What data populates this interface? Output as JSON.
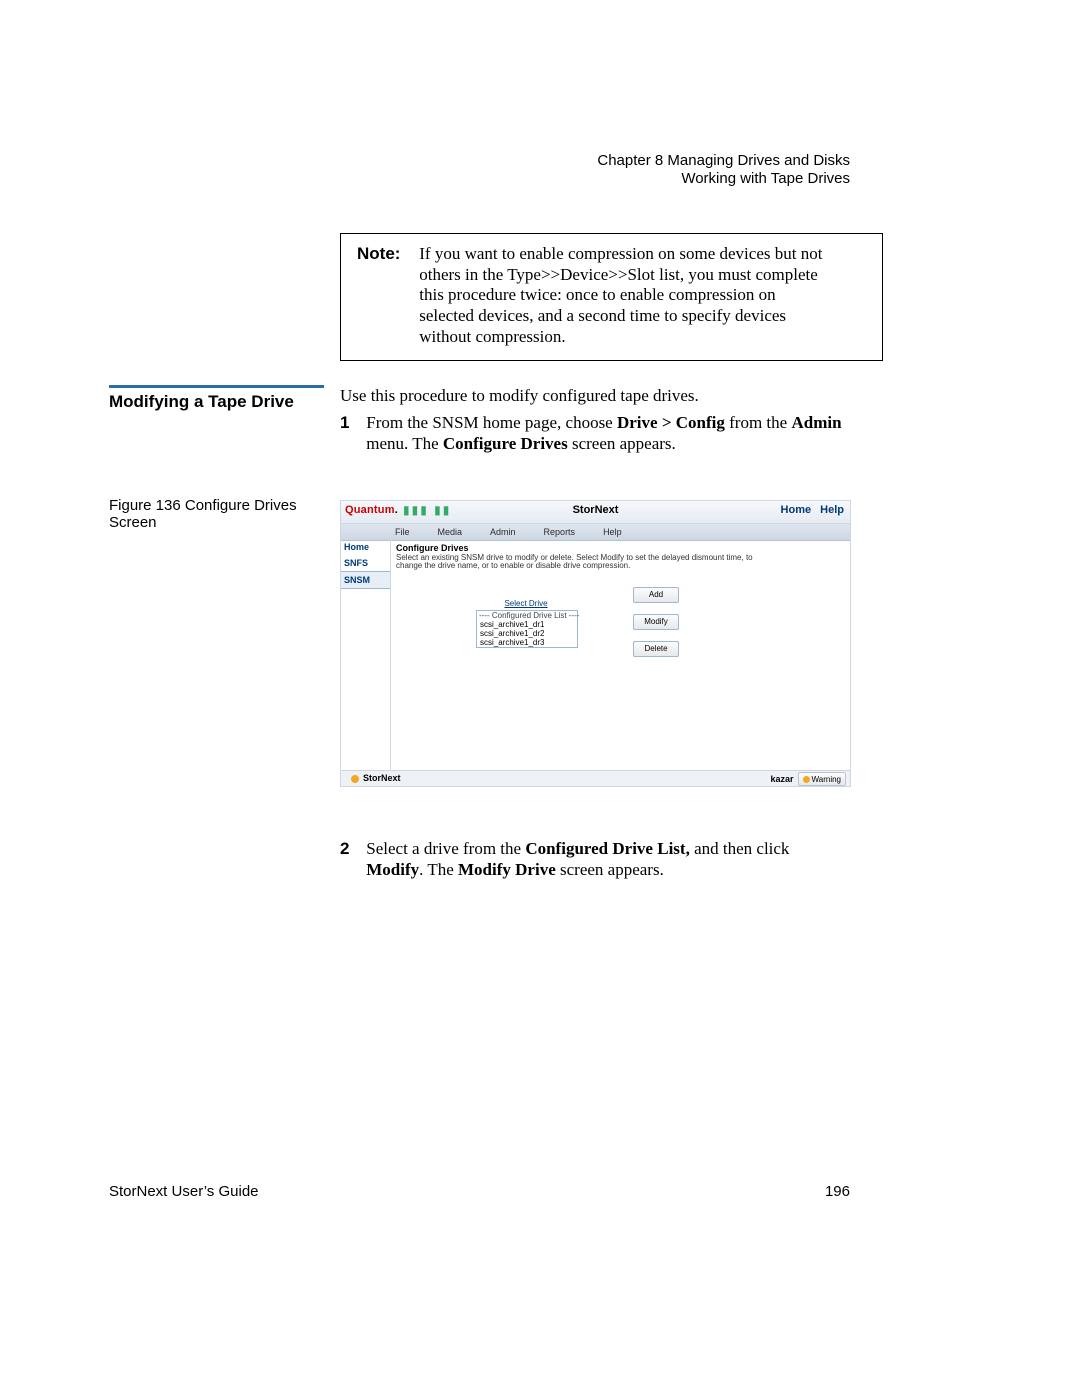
{
  "header": {
    "chapter": "Chapter 8  Managing Drives and Disks",
    "section": "Working with Tape Drives"
  },
  "note": {
    "label": "Note:",
    "text": "If you want to enable compression on some devices but not others in the Type>>Device>>Slot list, you must complete this procedure twice: once to enable compression on selected devices, and a second time to specify devices without compression."
  },
  "section_title": "Modifying a Tape Drive",
  "intro": "Use this procedure to modify configured tape drives.",
  "step1": {
    "num": "1",
    "pre": "From the SNSM home page, choose ",
    "bold1": "Drive > Config",
    "mid": " from the ",
    "bold2": "Admin",
    "post1": " menu. The ",
    "bold3": "Configure Drives",
    "post2": " screen appears."
  },
  "figure_caption": "Figure 136  Configure Drives Screen",
  "screenshot": {
    "brand": "Quantum",
    "brand_dot": ".",
    "app_title": "StorNext",
    "links": {
      "home": "Home",
      "help": "Help"
    },
    "menu": [
      "File",
      "Media",
      "Admin",
      "Reports",
      "Help"
    ],
    "sidebar": [
      "Home",
      "SNFS",
      "SNSM"
    ],
    "sidebar_active_index": 2,
    "panel_title": "Configure Drives",
    "panel_desc": "Select an existing SNSM drive to modify or delete. Select Modify to set the delayed dismount time, to change the drive name, or to enable or disable drive compression.",
    "select_label": "Select Drive",
    "list_caption": "---- Configured Drive List ----",
    "list_items": [
      "scsi_archive1_dr1",
      "scsi_archive1_dr2",
      "scsi_archive1_dr3"
    ],
    "buttons": [
      "Add",
      "Modify",
      "Delete"
    ],
    "status": {
      "product": "StorNext",
      "user": "kazar",
      "warning_label": "Warning"
    }
  },
  "step2": {
    "num": "2",
    "pre": "Select a drive from the ",
    "bold1": "Configured Drive List,",
    "mid": " and then click ",
    "bold2": "Modify",
    "post1": ". The ",
    "bold3": "Modify Drive",
    "post2": " screen appears."
  },
  "footer": {
    "left": "StorNext User’s Guide",
    "page": "196"
  }
}
